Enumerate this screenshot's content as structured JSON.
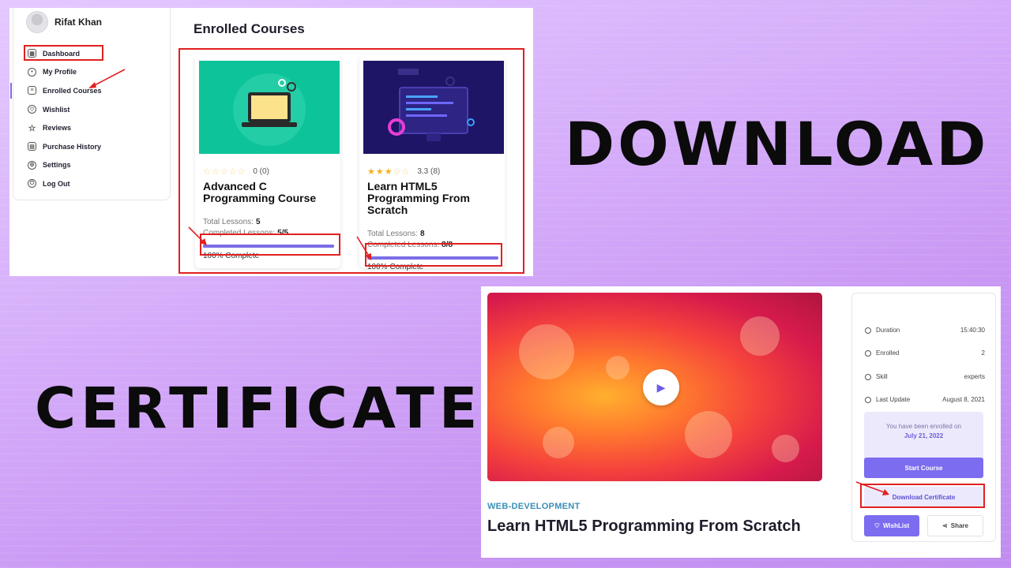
{
  "headings": {
    "download": "DOWNLOAD",
    "certificate": "CERTIFICATE"
  },
  "dashboard": {
    "profile_name": "Rifat Khan",
    "menu": [
      {
        "label": "Dashboard",
        "icon": "dashboard-icon"
      },
      {
        "label": "My Profile",
        "icon": "user-icon"
      },
      {
        "label": "Enrolled Courses",
        "icon": "book-icon"
      },
      {
        "label": "Wishlist",
        "icon": "heart-icon"
      },
      {
        "label": "Reviews",
        "icon": "star-icon"
      },
      {
        "label": "Purchase History",
        "icon": "cart-icon"
      },
      {
        "label": "Settings",
        "icon": "gear-icon"
      },
      {
        "label": "Log Out",
        "icon": "logout-icon"
      }
    ],
    "active_menu_index": 2,
    "section_title": "Enrolled Courses",
    "courses": [
      {
        "rating_text": "0 (0)",
        "stars_filled": 0,
        "title": "Advanced C Programming Course",
        "total_lessons_label": "Total Lessons:",
        "total_lessons": "5",
        "completed_lessons_label": "Completed Lessons:",
        "completed_lessons": "5/5",
        "progress": 1.0,
        "complete_text": "100% Complete",
        "thumb_color": "#0dc39a"
      },
      {
        "rating_text": "3.3 (8)",
        "stars_filled": 3,
        "title": "Learn HTML5 Programming From Scratch",
        "total_lessons_label": "Total Lessons:",
        "total_lessons": "8",
        "completed_lessons_label": "Completed Lessons:",
        "completed_lessons": "8/8",
        "progress": 1.0,
        "complete_text": "100% Complete",
        "thumb_color": "#1e1566"
      }
    ]
  },
  "course_detail": {
    "category": "WEB-DEVELOPMENT",
    "title": "Learn HTML5 Programming From Scratch",
    "info": [
      {
        "label": "Duration",
        "value": "15:40:30",
        "icon": "clock-icon"
      },
      {
        "label": "Enrolled",
        "value": "2",
        "icon": "users-icon"
      },
      {
        "label": "Skill",
        "value": "experts",
        "icon": "shield-icon"
      },
      {
        "label": "Last Update",
        "value": "August 8, 2021",
        "icon": "calendar-icon"
      }
    ],
    "enroll_note": "You have been enrolled on",
    "enroll_date": "July 21, 2022",
    "start_button": "Start Course",
    "download_button": "Download Certificate",
    "wishlist_button": "WishList",
    "share_button": "Share"
  },
  "colors": {
    "accent": "#7b6cf0",
    "highlight": "#e02020"
  }
}
